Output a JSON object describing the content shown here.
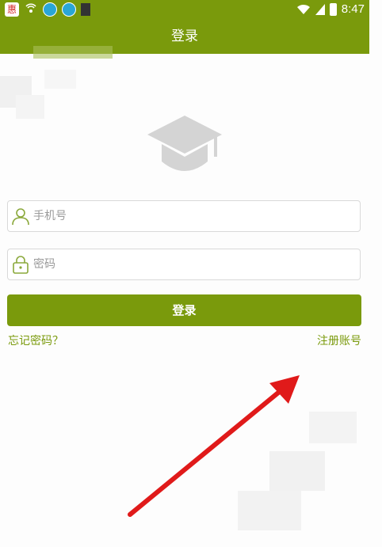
{
  "status_bar": {
    "time": "8:47",
    "app_badge_text": "惠"
  },
  "header": {
    "title": "登录"
  },
  "form": {
    "phone_placeholder": "手机号",
    "password_placeholder": "密码",
    "login_label": "登录"
  },
  "links": {
    "forgot_password": "忘记密码？",
    "register": "注册账号"
  },
  "colors": {
    "brand": "#7a9a0c",
    "annotation_arrow": "#e01a1a"
  },
  "icons": {
    "hero": "graduation-cap-icon",
    "phone_field": "user-icon",
    "password_field": "lock-icon"
  }
}
